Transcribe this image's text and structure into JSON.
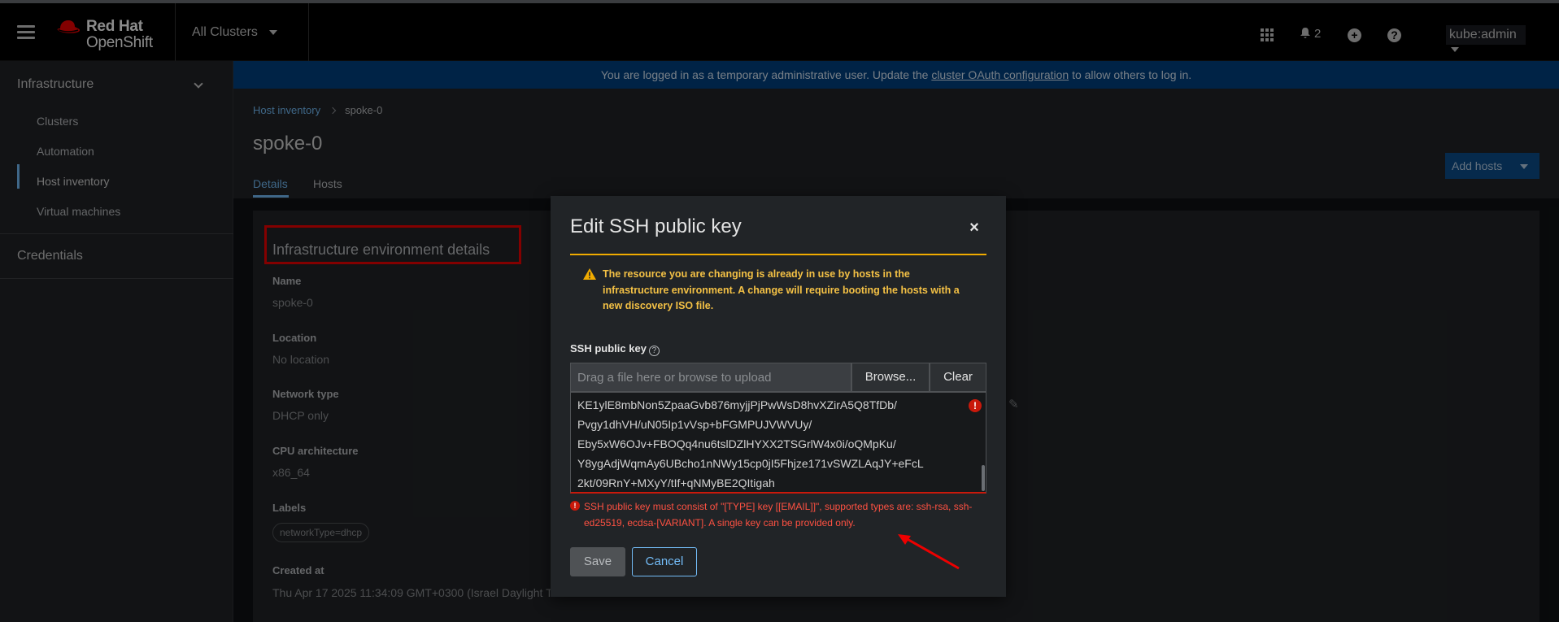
{
  "masthead": {
    "brand_line1": "Red Hat",
    "brand_line2": "OpenShift",
    "cluster_selector": "All Clusters",
    "notifications_count": "2",
    "user": "kube:admin"
  },
  "sidebar": {
    "group": "Infrastructure",
    "items": [
      {
        "label": "Clusters"
      },
      {
        "label": "Automation"
      },
      {
        "label": "Host inventory"
      },
      {
        "label": "Virtual machines"
      }
    ],
    "credentials": "Credentials"
  },
  "banner": {
    "text_before": "You are logged in as a temporary administrative user. Update the ",
    "link": "cluster OAuth configuration",
    "text_after": " to allow others to log in."
  },
  "page": {
    "breadcrumb_link": "Host inventory",
    "breadcrumb_current": "spoke-0",
    "title": "spoke-0",
    "tabs": [
      "Details",
      "Hosts"
    ],
    "add_hosts": "Add hosts"
  },
  "details": {
    "section_title": "Infrastructure environment details",
    "fields": [
      {
        "label": "Name",
        "value": "spoke-0"
      },
      {
        "label": "Location",
        "value": "No location"
      },
      {
        "label": "Network type",
        "value": "DHCP only"
      },
      {
        "label": "CPU architecture",
        "value": "x86_64"
      },
      {
        "label": "Labels",
        "value": "networkType=dhcp"
      },
      {
        "label": "Created at",
        "value": "Thu Apr 17 2025 11:34:09 GMT+0300 (Israel Daylight Ti"
      }
    ]
  },
  "modal": {
    "title": "Edit SSH public key",
    "close": "×",
    "warning": "The resource you are changing is already in use by hosts in the infrastructure environment. A change will require booting the hosts with a new discovery ISO file.",
    "ssh_label": "SSH public key",
    "help": "?",
    "upload_placeholder": "Drag a file here or browse to upload",
    "browse": "Browse...",
    "clear": "Clear",
    "key_lines": [
      "KE1ylE8mbNon5ZpaaGvb876myjjPjPwWsD8hvXZirA5Q8TfDb/",
      "Pvgy1dhVH/uN05Ip1vVsp+bFGMPUJVWVUy/",
      "Eby5xW6OJv+FBOQq4nu6tslDZlHYXX2TSGrlW4x0i/oQMpKu/",
      "Y8ygAdjWqmAy6UBcho1nNWy15cp0jI5Fhjze171vSWZLAqJY+eFcL",
      "2kt/09RnY+MXyY/tIf+qNMyBE2QItigah"
    ],
    "error": "SSH public key must consist of \"[TYPE] key [[EMAIL]]\", supported types are: ssh-rsa, ssh-ed25519, ecdsa-[VARIANT]. A single key can be provided only.",
    "save": "Save",
    "cancel": "Cancel"
  },
  "colors": {
    "accent": "#73bcf7",
    "warning": "#f4c145",
    "danger": "#c9190b",
    "annotation": "#e00000"
  }
}
